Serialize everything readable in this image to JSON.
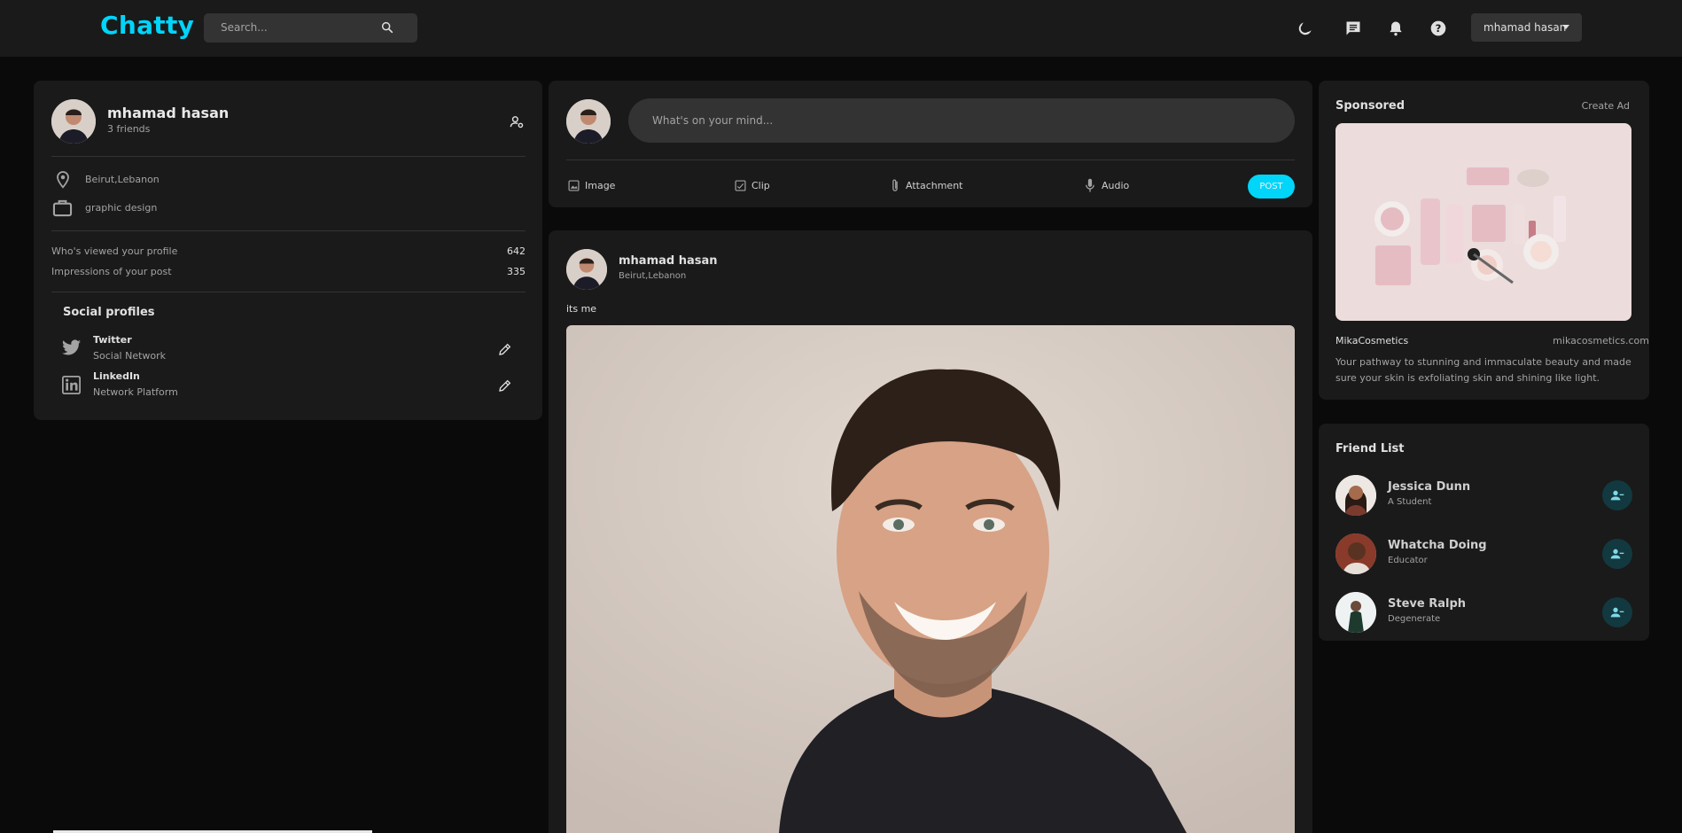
{
  "app": {
    "logo": "Chatty"
  },
  "search": {
    "placeholder": "Search..."
  },
  "nav": {
    "user_menu_label": "mhamad hasan",
    "icons": [
      "moon-icon",
      "message-icon",
      "bell-icon",
      "help-icon"
    ]
  },
  "profile": {
    "name": "mhamad hasan",
    "friends": "3 friends",
    "location": "Beirut,Lebanon",
    "occupation": "graphic design",
    "stats": [
      {
        "label": "Who's viewed your profile",
        "value": "642"
      },
      {
        "label": "Impressions of your post",
        "value": "335"
      }
    ],
    "social_title": "Social profiles",
    "social": [
      {
        "name": "Twitter",
        "type": "Social Network"
      },
      {
        "name": "LinkedIn",
        "type": "Network Platform"
      }
    ]
  },
  "composer": {
    "placeholder": "What's on your mind...",
    "actions": [
      "Image",
      "Clip",
      "Attachment",
      "Audio"
    ],
    "post_label": "POST"
  },
  "post": {
    "author": "mhamad hasan",
    "location": "Beirut,Lebanon",
    "text": "its me"
  },
  "sponsored": {
    "title": "Sponsored",
    "create_ad": "Create Ad",
    "brand": "MikaCosmetics",
    "url": "mikacosmetics.com",
    "description_line1": "Your pathway to stunning and immaculate beauty and made",
    "description_line2": "sure your skin is exfoliating skin and shining like light."
  },
  "friend_list": {
    "title": "Friend List",
    "friends": [
      {
        "name": "Jessica Dunn",
        "subtitle": "A Student"
      },
      {
        "name": "Whatcha Doing",
        "subtitle": "Educator"
      },
      {
        "name": "Steve Ralph",
        "subtitle": "Degenerate"
      }
    ]
  },
  "colors": {
    "accent": "#00d5fa",
    "background": "#0a0a0a",
    "card": "#1a1a1a",
    "input": "#333333"
  }
}
